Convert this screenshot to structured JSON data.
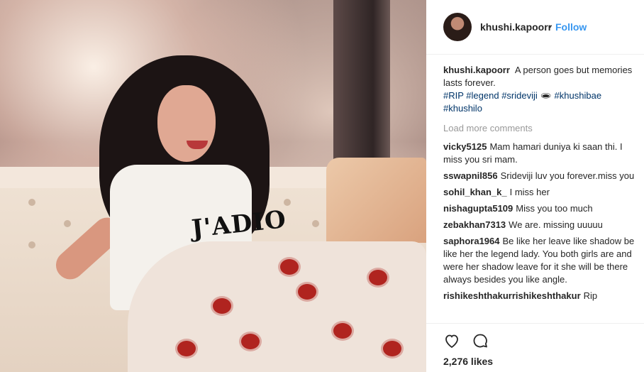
{
  "post": {
    "username": "khushi.kapoorr",
    "separator": "•",
    "follow_label": "Follow",
    "caption": {
      "user": "khushi.kapoorr",
      "text": "A person goes but memories lasts forever.",
      "hashtags": [
        "#RIP",
        "#legend",
        "#srideviji"
      ],
      "emoji": "🕳",
      "hashtags2": [
        "#khushibae",
        "#khushilo"
      ]
    },
    "load_more": "Load more comments",
    "comments": [
      {
        "user": "vicky5125",
        "text": "Mam hamari duniya ki saan thi. I miss you sri mam."
      },
      {
        "user": "sswapnil856",
        "text": "Srideviji luv you forever.miss you"
      },
      {
        "user": "sohil_khan_k_",
        "text": "I miss her"
      },
      {
        "user": "nishagupta5109",
        "text": "Miss you too much"
      },
      {
        "user": "zebakhan7313",
        "text": "We are. missing uuuuu"
      },
      {
        "user": "saphora1964",
        "text": "Be like her leave like shadow be like her the legend lady. You both girls are and were her shadow leave for it she will be there always besides you like angle."
      },
      {
        "user": "rishikeshthakurrishikeshthakur",
        "text": "Rip"
      }
    ],
    "likes": "2,276 likes"
  },
  "photo": {
    "shirt_text": "J'ADIO"
  }
}
